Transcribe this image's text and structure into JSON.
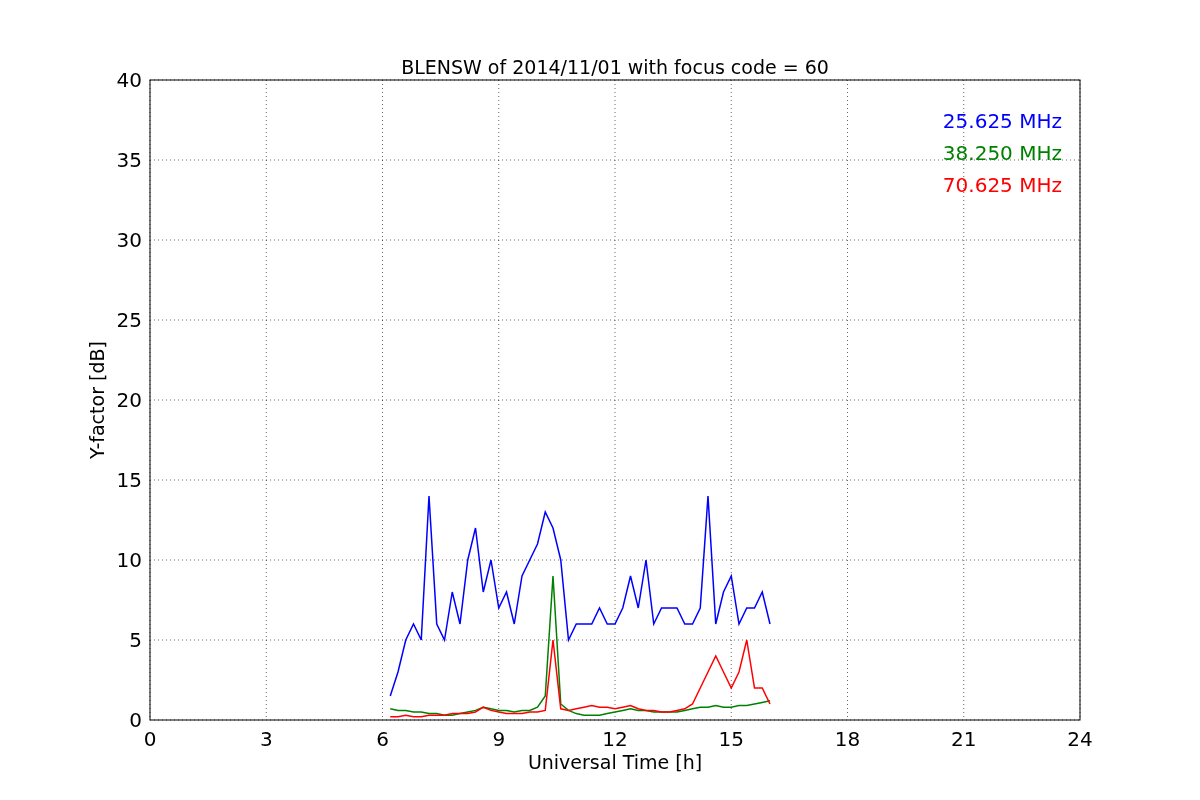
{
  "figure": {
    "chart_data": {
      "type": "line",
      "title": "BLENSW of 2014/11/01 with focus code = 60",
      "xlabel": "Universal Time [h]",
      "ylabel": "Y-factor [dB]",
      "grid": true,
      "xlim": [
        0,
        24
      ],
      "ylim": [
        0,
        40
      ],
      "xticks": [
        0,
        3,
        6,
        9,
        12,
        15,
        18,
        21,
        24
      ],
      "yticks": [
        0,
        5,
        10,
        15,
        20,
        25,
        30,
        35,
        40
      ],
      "x": [
        6.2,
        6.4,
        6.6,
        6.8,
        7.0,
        7.2,
        7.4,
        7.6,
        7.8,
        8.0,
        8.2,
        8.4,
        8.6,
        8.8,
        9.0,
        9.2,
        9.4,
        9.6,
        9.8,
        10.0,
        10.2,
        10.4,
        10.6,
        10.8,
        11.0,
        11.2,
        11.4,
        11.6,
        11.8,
        12.0,
        12.2,
        12.4,
        12.6,
        12.8,
        13.0,
        13.2,
        13.4,
        13.6,
        13.8,
        14.0,
        14.2,
        14.4,
        14.6,
        14.8,
        15.0,
        15.2,
        15.4,
        15.6,
        15.8,
        16.0
      ],
      "series": [
        {
          "name": "25.625 MHz",
          "color": "#0000ff",
          "values": [
            1.5,
            3,
            5,
            6,
            5,
            14,
            6,
            5,
            8,
            6,
            10,
            12,
            8,
            10,
            7,
            8,
            6,
            9,
            10,
            11,
            13,
            12,
            10,
            5,
            6,
            6,
            6,
            7,
            6,
            6,
            7,
            9,
            7,
            10,
            6,
            7,
            7,
            7,
            6,
            6,
            7,
            14,
            6,
            8,
            9,
            6,
            7,
            7,
            8,
            6
          ]
        },
        {
          "name": "38.250 MHz",
          "color": "#008000",
          "values": [
            0.7,
            0.6,
            0.6,
            0.5,
            0.5,
            0.4,
            0.4,
            0.3,
            0.3,
            0.4,
            0.5,
            0.6,
            0.8,
            0.7,
            0.6,
            0.6,
            0.5,
            0.6,
            0.6,
            0.8,
            1.5,
            9,
            1,
            0.6,
            0.4,
            0.3,
            0.3,
            0.3,
            0.4,
            0.5,
            0.6,
            0.7,
            0.6,
            0.6,
            0.5,
            0.5,
            0.5,
            0.5,
            0.6,
            0.7,
            0.8,
            0.8,
            0.9,
            0.8,
            0.8,
            0.9,
            0.9,
            1,
            1.1,
            1.2
          ]
        },
        {
          "name": "70.625 MHz",
          "color": "#ff0000",
          "values": [
            0.2,
            0.2,
            0.3,
            0.2,
            0.2,
            0.3,
            0.3,
            0.3,
            0.4,
            0.4,
            0.4,
            0.5,
            0.8,
            0.6,
            0.5,
            0.4,
            0.4,
            0.4,
            0.5,
            0.5,
            0.6,
            5,
            0.7,
            0.6,
            0.7,
            0.8,
            0.9,
            0.8,
            0.8,
            0.7,
            0.8,
            0.9,
            0.7,
            0.6,
            0.6,
            0.5,
            0.5,
            0.6,
            0.7,
            1,
            2,
            3,
            4,
            3,
            2,
            3,
            5,
            2,
            2,
            1
          ]
        }
      ]
    }
  }
}
